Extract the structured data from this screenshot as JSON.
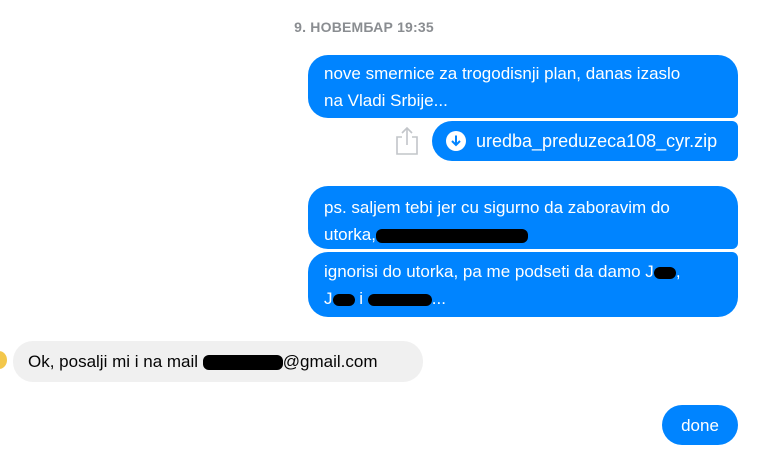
{
  "conversation": {
    "timestamp": "9. НОВЕМБАР 19:35",
    "messages": {
      "m1_line1": "nove smernice za trogodisnji plan, danas izaslo",
      "m1_line2": "na Vladi Srbije...",
      "attachment_name": "uredba_preduzeca108_cyr.zip",
      "m2_line1": "ps. saljem tebi jer cu sigurno da zaboravim do",
      "m2_line2_prefix": "utorka,",
      "m3_line1": "ignorisi do utorka, pa me podseti da damo J",
      "m3_line2_mid": "i",
      "m3_line2_suffix": "...",
      "incoming_prefix": "Ok, posalji mi i na mail ",
      "incoming_suffix": "@gmail.com",
      "m4": "done"
    },
    "icons": {
      "attachment": "download-icon",
      "share": "share-icon"
    },
    "colors": {
      "outgoing_bubble": "#0084ff",
      "incoming_bubble": "#f0f0f0",
      "timestamp_text": "#8a8d91",
      "redaction": "#000000"
    }
  }
}
